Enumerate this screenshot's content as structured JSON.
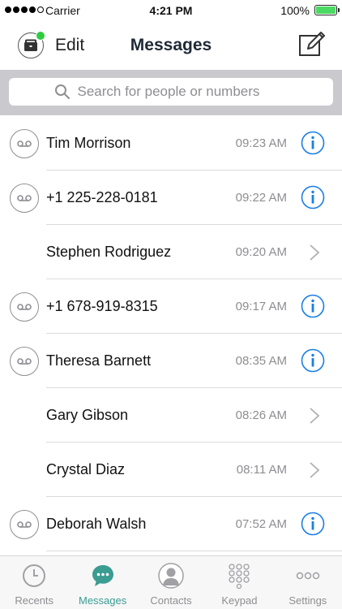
{
  "status_bar": {
    "carrier": "Carrier",
    "time": "4:21 PM",
    "battery": "100%"
  },
  "nav": {
    "edit_label": "Edit",
    "title": "Messages"
  },
  "search": {
    "placeholder": "Search for people or numbers"
  },
  "messages": [
    {
      "name": "Tim Morrison",
      "time": "09:23 AM",
      "voicemail": true,
      "action": "info"
    },
    {
      "name": "+1 225-228-0181",
      "time": "09:22 AM",
      "voicemail": true,
      "action": "info"
    },
    {
      "name": "Stephen Rodriguez",
      "time": "09:20 AM",
      "voicemail": false,
      "action": "chevron"
    },
    {
      "name": "+1 678-919-8315",
      "time": "09:17 AM",
      "voicemail": true,
      "action": "info"
    },
    {
      "name": "Theresa Barnett",
      "time": "08:35 AM",
      "voicemail": true,
      "action": "info"
    },
    {
      "name": "Gary Gibson",
      "time": "08:26 AM",
      "voicemail": false,
      "action": "chevron"
    },
    {
      "name": "Crystal Diaz",
      "time": "08:11 AM",
      "voicemail": false,
      "action": "chevron"
    },
    {
      "name": "Deborah Walsh",
      "time": "07:52 AM",
      "voicemail": true,
      "action": "info"
    }
  ],
  "tabs": [
    {
      "label": "Recents",
      "icon": "clock-icon",
      "active": false
    },
    {
      "label": "Messages",
      "icon": "chat-bubble-icon",
      "active": true
    },
    {
      "label": "Contacts",
      "icon": "person-icon",
      "active": false
    },
    {
      "label": "Keypad",
      "icon": "keypad-icon",
      "active": false
    },
    {
      "label": "Settings",
      "icon": "more-icon",
      "active": false
    }
  ],
  "colors": {
    "accent": "#3b9c92",
    "info_blue": "#1a7ee6",
    "presence": "#2ecc40",
    "battery": "#4cd964"
  }
}
